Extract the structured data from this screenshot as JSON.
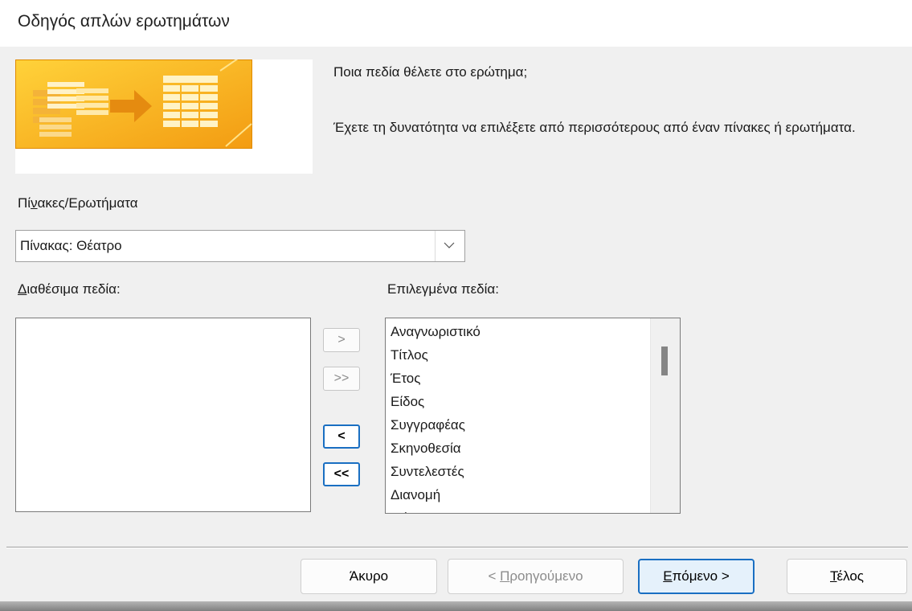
{
  "window": {
    "title": "Οδηγός απλών ερωτημάτων"
  },
  "prompt": {
    "question": "Ποια πεδία θέλετε στο ερώτημα;",
    "description": "Έχετε τη δυνατότητα να επιλέξετε από περισσότερους από έναν πίνακες ή ερωτήματα."
  },
  "tables_queries": {
    "label_pre": "Πί",
    "label_accel": "ν",
    "label_post": "ακες/Ερωτήματα",
    "selected_value": "Πίνακας: Θέατρο"
  },
  "available_fields": {
    "label_accel": "Δ",
    "label_post": "ιαθέσιμα πεδία:",
    "items": []
  },
  "selected_fields": {
    "label": "Επιλεγμένα πεδία:",
    "items": [
      "Αναγνωριστικό",
      "Τίτλος",
      "Έτος",
      "Είδος",
      "Συγγραφέας",
      "Σκηνοθεσία",
      "Συντελεστές",
      "Διανομή",
      "Μέρος"
    ]
  },
  "move_buttons": {
    "add_one": ">",
    "add_all": ">>",
    "remove_one": "<",
    "remove_all": "<<"
  },
  "nav": {
    "cancel": "Άκυρο",
    "back_prefix": "< ",
    "back_accel": "Π",
    "back_rest": "ροηγούμενο",
    "next_accel": "Ε",
    "next_rest": "πόμενο >",
    "finish_accel": "Τ",
    "finish_rest": "έλος"
  },
  "colors": {
    "accent": "#1a6fc2",
    "dialog_bg": "#f0f0f0",
    "wizard_image_orange": "#f6a623"
  }
}
